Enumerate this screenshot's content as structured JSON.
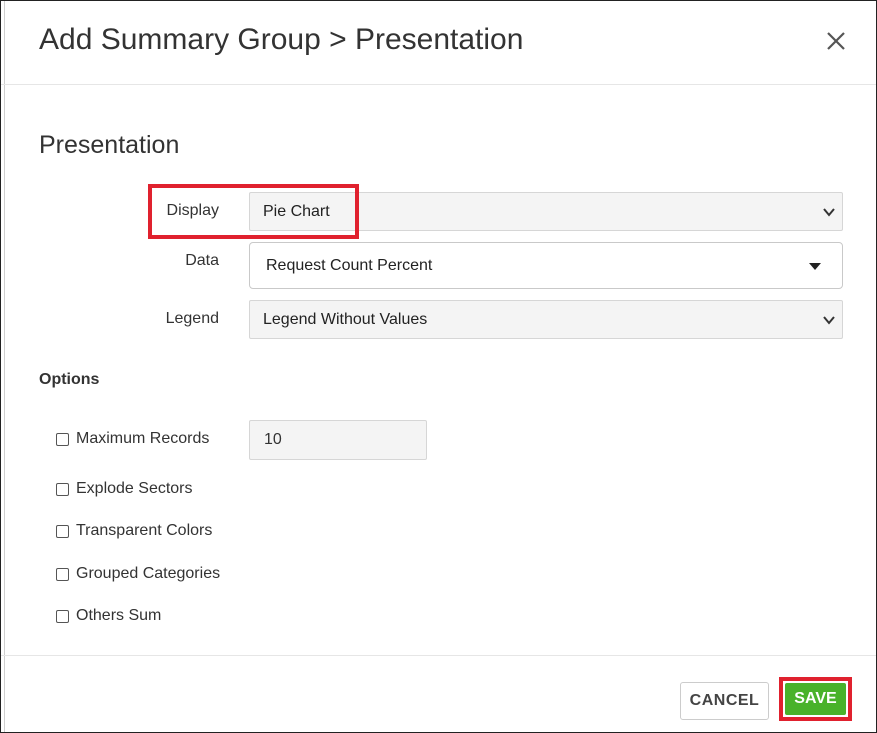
{
  "dialog": {
    "title": "Add Summary Group > Presentation",
    "close_icon": "close-icon"
  },
  "section": {
    "title": "Presentation"
  },
  "fields": {
    "display": {
      "label": "Display",
      "value": "Pie Chart"
    },
    "data": {
      "label": "Data",
      "value": "Request Count Percent"
    },
    "legend": {
      "label": "Legend",
      "value": "Legend Without Values"
    }
  },
  "options": {
    "heading": "Options",
    "items": [
      {
        "label": "Maximum Records",
        "checked": false
      },
      {
        "label": "Explode Sectors",
        "checked": false
      },
      {
        "label": "Transparent Colors",
        "checked": false
      },
      {
        "label": "Grouped Categories",
        "checked": false
      },
      {
        "label": "Others Sum",
        "checked": false
      }
    ],
    "max_records_value": "10"
  },
  "footer": {
    "cancel_label": "CANCEL",
    "save_label": "SAVE"
  },
  "colors": {
    "highlight": "#e0212e",
    "save_button": "#49b22a",
    "text": "#333333"
  }
}
